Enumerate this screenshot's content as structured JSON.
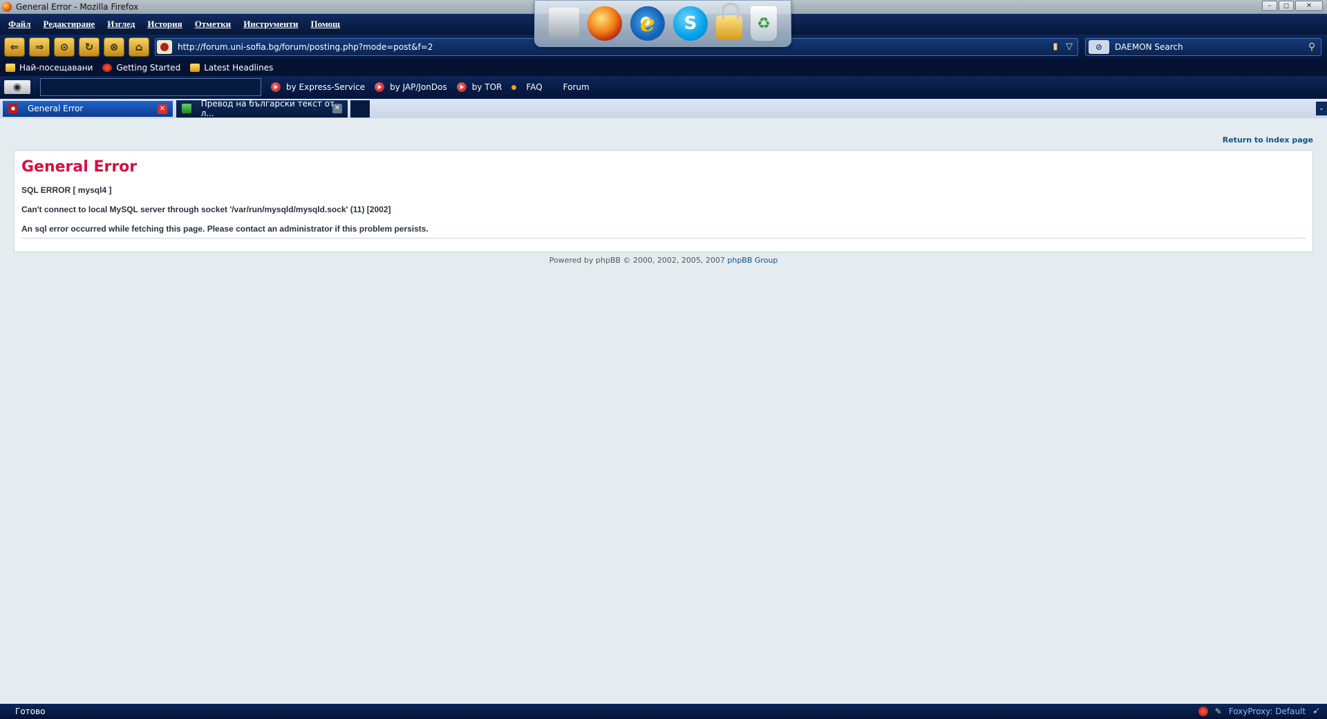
{
  "window": {
    "title": "General Error - Mozilla Firefox",
    "minimize": "–",
    "maximize": "◻",
    "close": "✕"
  },
  "menu": [
    "Файл",
    "Редактиране",
    "Изглед",
    "История",
    "Отметки",
    "Инструменти",
    "Помощ"
  ],
  "dock": {
    "ie_glyph": "e",
    "skype_glyph": "S",
    "trash_glyph": "♻"
  },
  "navigation": {
    "back": "⇐",
    "forward": "⇒",
    "compare": "⊙",
    "reload": "↻",
    "stop": "⊗",
    "home": "⌂",
    "url": "http://forum.uni-sofia.bg/forum/posting.php?mode=post&f=2",
    "bookmark_glyph": "▮",
    "dropdown_glyph": "▽"
  },
  "search": {
    "placeholder": "DAEMON Search",
    "engine_glyph": "⊘",
    "go_glyph": "⚲"
  },
  "bookmarks": [
    "Най-посещавани",
    "Getting Started",
    "Latest Headlines"
  ],
  "extension_toolbar": {
    "eye_glyph": "◉",
    "links": [
      "by Express-Service",
      "by JAP/JonDos",
      "by TOR",
      "FAQ",
      "Forum"
    ]
  },
  "tabs": [
    {
      "label": "General Error",
      "active": true
    },
    {
      "label": "Превод на български текст от л...",
      "active": false
    }
  ],
  "tab_close_glyph": "✕",
  "tab_list_glyph": "⌄",
  "page": {
    "return_link": "Return to index page",
    "error_title": "General Error",
    "error_lines": [
      "SQL ERROR [ mysql4 ]",
      "Can't connect to local MySQL server through socket '/var/run/mysqld/mysqld.sock' (11) [2002]",
      "An sql error occurred while fetching this page. Please contact an administrator if this problem persists."
    ],
    "footer_text": "Powered by phpBB © 2000, 2002, 2005, 2007 ",
    "footer_link": "phpBB Group"
  },
  "status": {
    "text": "Готово",
    "proxy": "FoxyProxy: Default",
    "pen_glyph": "✎",
    "fox_glyph": "➹"
  }
}
